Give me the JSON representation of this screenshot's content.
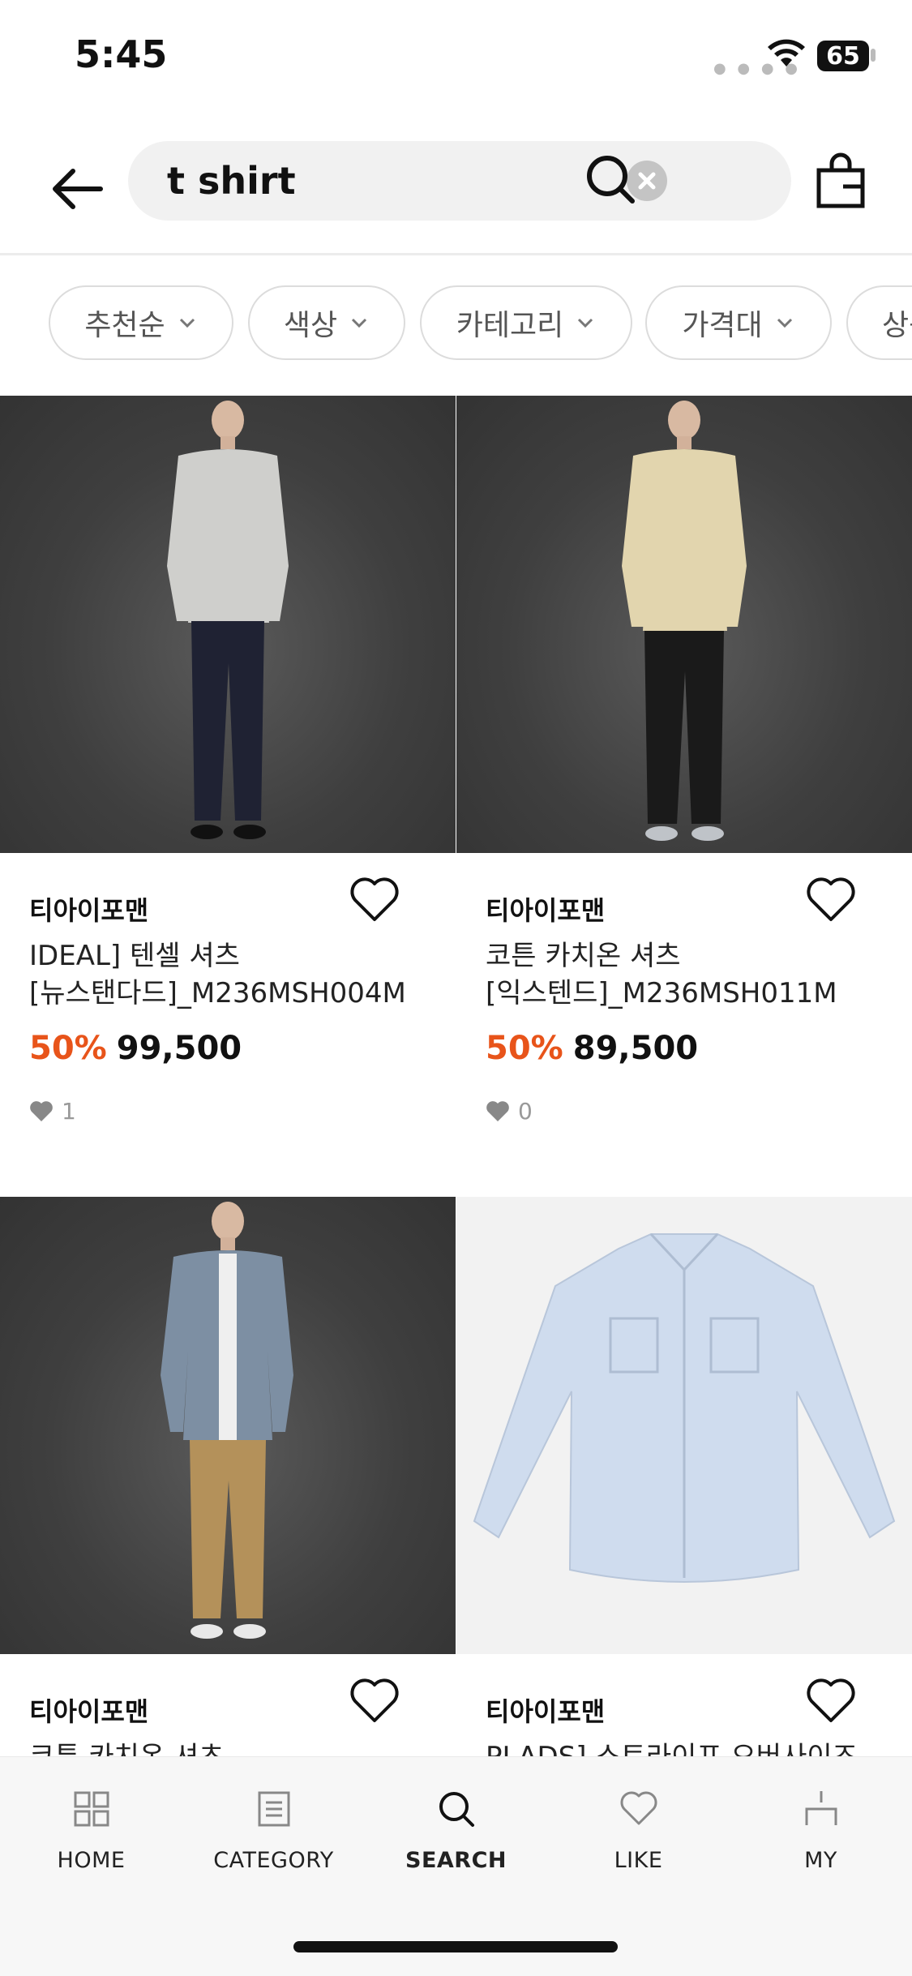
{
  "status_bar": {
    "time": "5:45",
    "battery": "65"
  },
  "search": {
    "query": "t shirt"
  },
  "filters": [
    "추천순",
    "색상",
    "카테고리",
    "가격대",
    "상품"
  ],
  "products": [
    {
      "brand": "티아이포맨",
      "title_line1": "IDEAL] 텐셀 셔츠",
      "title_line2": "[뉴스탠다드]_M236MSH004M",
      "discount": "50%",
      "price": "99,500",
      "likes": "1"
    },
    {
      "brand": "티아이포맨",
      "title_line1": "코튼 카치온 셔츠",
      "title_line2": "[익스텐드]_M236MSH011M",
      "discount": "50%",
      "price": "89,500",
      "likes": "0"
    },
    {
      "brand": "티아이포맨",
      "title_line1": "코튼 카치온 셔츠",
      "title_line2": "",
      "discount": "",
      "price": "",
      "likes": ""
    },
    {
      "brand": "티아이포맨",
      "title_line1": "PLADS] 스트라이프 오버사이즈",
      "title_line2": "",
      "discount": "",
      "price": "",
      "likes": ""
    }
  ],
  "nav": [
    {
      "label": "HOME",
      "icon": "grid-icon"
    },
    {
      "label": "CATEGORY",
      "icon": "list-icon"
    },
    {
      "label": "SEARCH",
      "icon": "search-icon"
    },
    {
      "label": "LIKE",
      "icon": "heart-icon"
    },
    {
      "label": "MY",
      "icon": "person-icon"
    }
  ],
  "colors": {
    "discount": "#e8541a",
    "text": "#111111",
    "chip_border": "#dcdcdc"
  }
}
